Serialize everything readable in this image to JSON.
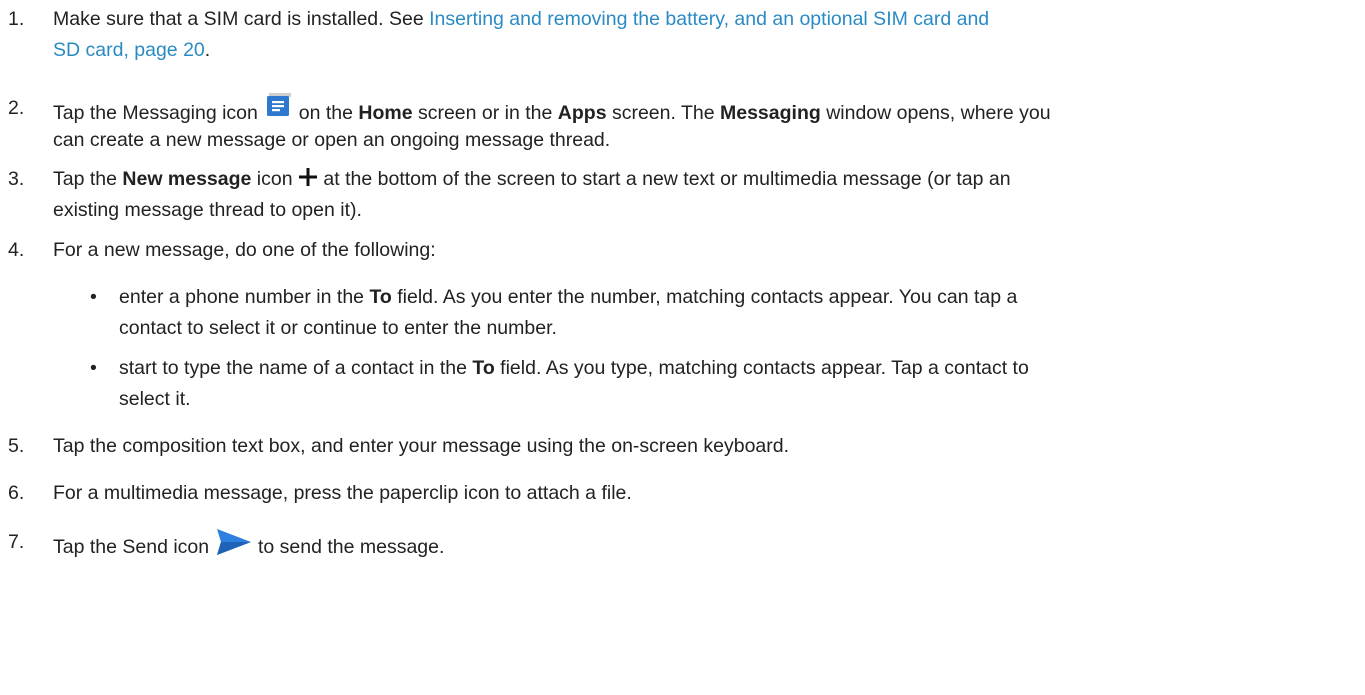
{
  "steps": [
    {
      "num": "1.",
      "pre": "Make sure that a SIM card is installed.  See ",
      "link_line1": "Inserting and removing the battery, and an optional SIM card and",
      "link_line2": "SD card, page 20",
      "post": "."
    },
    {
      "num": "2.",
      "a": "Tap the Messaging icon ",
      "b": " on the ",
      "home": "Home",
      "c": " screen or in the ",
      "apps": "Apps",
      "d": " screen. The ",
      "messaging": "Messaging",
      "e": " window opens, where you",
      "line2": "can create a new message or open an ongoing message thread."
    },
    {
      "num": "3.",
      "a": "Tap the ",
      "new_message": "New message",
      "b": " icon ",
      "c": " at the bottom of the screen to start a new text or multimedia message (or tap an",
      "line2": "existing message thread to open it)."
    },
    {
      "num": "4.",
      "text": "For a new message, do one of the following:"
    },
    {
      "num": "5.",
      "text": "Tap the composition text box, and enter your message using the on-screen keyboard."
    },
    {
      "num": "6.",
      "text": "For a multimedia message, press the paperclip icon to attach a file."
    },
    {
      "num": "7.",
      "a": "Tap the Send icon ",
      "b": " to send the message."
    }
  ],
  "bullets": [
    {
      "dot": "•",
      "a": "enter a phone number in the ",
      "to": "To",
      "b": " field. As you enter the number, matching contacts appear. You can tap a",
      "line2": "contact to select it or continue to enter the number."
    },
    {
      "dot": "•",
      "a": "start to type the name of a contact in the ",
      "to": "To",
      "b": " field. As you type, matching contacts appear. Tap a contact to",
      "line2": "select it."
    }
  ],
  "icons": {
    "messaging": "messaging-icon",
    "new_message": "plus-icon",
    "send": "send-icon"
  },
  "colors": {
    "link": "#2a8bc4",
    "messaging_icon": "#2f78d0",
    "send_icon": "#2d7fe0"
  }
}
